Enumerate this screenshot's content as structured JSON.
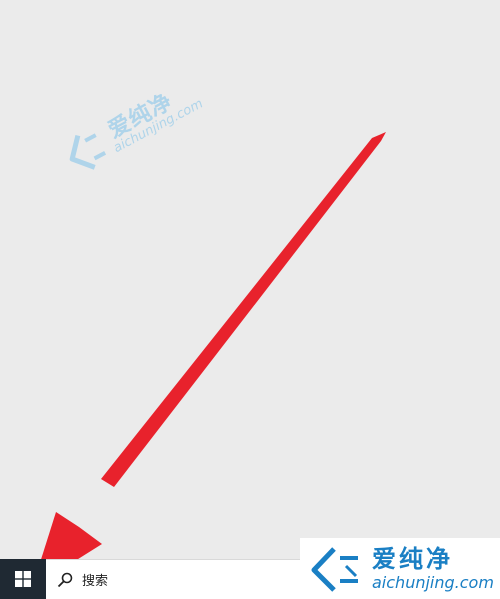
{
  "desktop": {
    "watermark": {
      "brand": "爱纯净",
      "url": "aichunjing.com"
    }
  },
  "taskbar": {
    "start_icon": "windows-logo-icon",
    "search": {
      "icon": "search-icon",
      "placeholder": "搜索"
    }
  },
  "badge": {
    "brand": "爱纯净",
    "url": "aichunjing.com"
  },
  "colors": {
    "desktop": "#ebebeb",
    "start_button": "#1f2933",
    "arrow": "#e8222c",
    "brand_blue": "#1a7fc4"
  }
}
